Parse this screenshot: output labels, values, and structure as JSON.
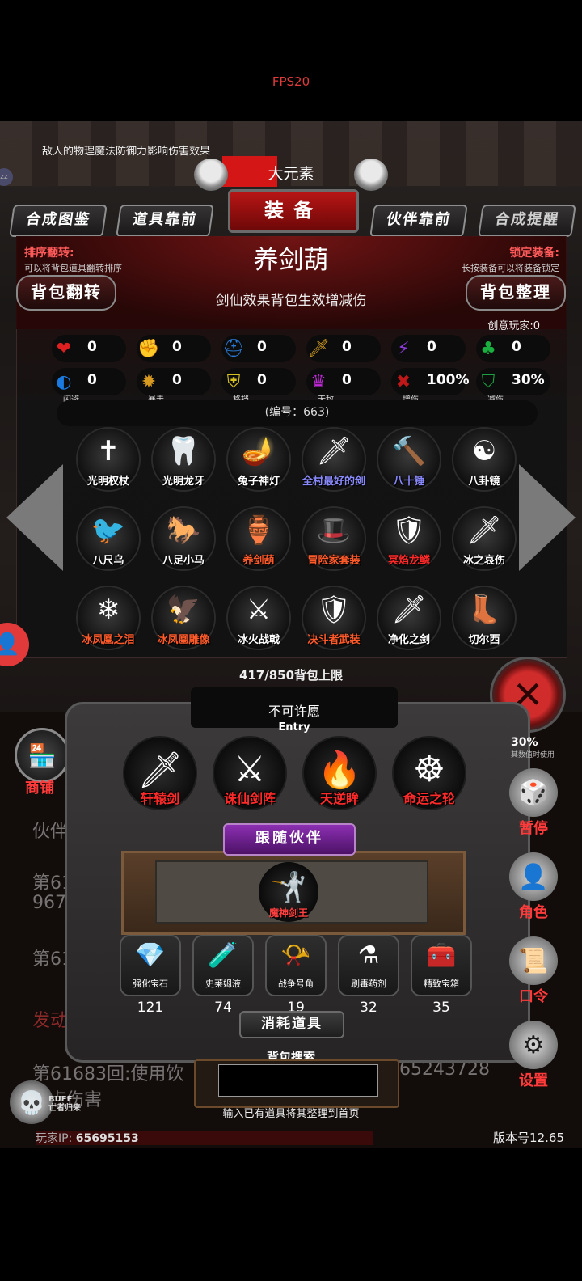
{
  "fps": "FPS20",
  "top_note": "敌人的物理魔法防御力影响伤害效果",
  "top_name": "大元素",
  "title": "装备",
  "nav": {
    "codex": "合成图鉴",
    "items_front": "道具靠前",
    "partner_front": "伙伴靠前",
    "reminder": "合成提醒"
  },
  "left_info": {
    "heading": "排序翻转:",
    "sub": "可以将背包道具翻转排序",
    "button": "背包翻转"
  },
  "right_info": {
    "heading": "锁定装备:",
    "sub": "长按装备可以将装备锁定",
    "button": "背包整理"
  },
  "item_name": "养剑葫",
  "item_desc": "剑仙效果背包生效增减伤",
  "creative_player": "创意玩家:0",
  "stats_row1": [
    {
      "icon": "heart-icon",
      "glyph": "❤",
      "value": "0",
      "color": "#e02020",
      "label": ""
    },
    {
      "icon": "strength-icon",
      "glyph": "✊",
      "value": "0",
      "color": "#d8b020",
      "label": ""
    },
    {
      "icon": "helmet-icon",
      "glyph": "⛑",
      "value": "0",
      "color": "#2a7ad8",
      "label": ""
    },
    {
      "icon": "sword-icon",
      "glyph": "🗡",
      "value": "0",
      "color": "#d8a020",
      "label": ""
    },
    {
      "icon": "lightning-icon",
      "glyph": "⚡",
      "value": "0",
      "color": "#8a3ad8",
      "label": ""
    },
    {
      "icon": "clover-icon",
      "glyph": "♣",
      "value": "0",
      "color": "#1ab040",
      "label": ""
    }
  ],
  "stats_row2": [
    {
      "icon": "dodge-icon",
      "glyph": "◐",
      "value": "0",
      "color": "#1a7ae0",
      "label": "闪避"
    },
    {
      "icon": "crit-icon",
      "glyph": "✹",
      "value": "0",
      "color": "#d89a20",
      "label": "暴击"
    },
    {
      "icon": "block-icon",
      "glyph": "⛨",
      "value": "0",
      "color": "#d8c020",
      "label": "格挡"
    },
    {
      "icon": "invincible-icon",
      "glyph": "♛",
      "value": "0",
      "color": "#c02ad8",
      "label": "无敌"
    },
    {
      "icon": "damage-up-icon",
      "glyph": "✖",
      "value": "100%",
      "color": "#c01818",
      "label": "增伤"
    },
    {
      "icon": "damage-reduce-icon",
      "glyph": "⛉",
      "value": "30%",
      "color": "#1aa040",
      "label": "减伤"
    }
  ],
  "serial": "(编号：663)",
  "inventory": [
    {
      "name": "光明权杖",
      "glyph": "✝",
      "color": "#ffffff"
    },
    {
      "name": "光明龙牙",
      "glyph": "🦷",
      "color": "#ffffff"
    },
    {
      "name": "兔子神灯",
      "glyph": "🪔",
      "color": "#ffffff"
    },
    {
      "name": "全村最好的剑",
      "glyph": "🗡",
      "color": "#8a8aff"
    },
    {
      "name": "八十锤",
      "glyph": "🔨",
      "color": "#8a8aff"
    },
    {
      "name": "八卦镜",
      "glyph": "☯",
      "color": "#ffffff"
    },
    {
      "name": "八尺乌",
      "glyph": "🐦",
      "color": "#ffffff"
    },
    {
      "name": "八足小马",
      "glyph": "🐎",
      "color": "#ffffff"
    },
    {
      "name": "养剑葫",
      "glyph": "🏺",
      "color": "#ff5a2a"
    },
    {
      "name": "冒险家套装",
      "glyph": "🎩",
      "color": "#ff5a2a"
    },
    {
      "name": "冥焰龙鳞",
      "glyph": "🛡",
      "color": "#ff2a2a"
    },
    {
      "name": "冰之哀伤",
      "glyph": "🗡",
      "color": "#ffffff"
    },
    {
      "name": "冰凤凰之泪",
      "glyph": "❄",
      "color": "#ff5a2a"
    },
    {
      "name": "冰凤凰雕像",
      "glyph": "🦅",
      "color": "#ff5a2a"
    },
    {
      "name": "冰火战戟",
      "glyph": "⚔",
      "color": "#ffffff"
    },
    {
      "name": "决斗者武装",
      "glyph": "🛡",
      "color": "#ff5a2a"
    },
    {
      "name": "净化之剑",
      "glyph": "🗡",
      "color": "#ffffff"
    },
    {
      "name": "切尔西",
      "glyph": "👢",
      "color": "#ffffff"
    }
  ],
  "capacity": "417/850背包上限",
  "wish": {
    "title": "不可许愿",
    "sub": "Entry",
    "items": [
      {
        "name": "轩辕剑",
        "glyph": "🗡"
      },
      {
        "name": "诛仙剑阵",
        "glyph": "⚔"
      },
      {
        "name": "天逆眸",
        "glyph": "🔥"
      },
      {
        "name": "命运之轮",
        "glyph": "☸"
      }
    ]
  },
  "follow": {
    "title": "跟随伙伴",
    "partner": {
      "name": "魔神剑王",
      "glyph": "🤺"
    }
  },
  "consumables": {
    "title": "消耗道具",
    "items": [
      {
        "name": "强化宝石",
        "glyph": "💎",
        "count": "121"
      },
      {
        "name": "史莱姆液",
        "glyph": "🧪",
        "count": "74"
      },
      {
        "name": "战争号角",
        "glyph": "📯",
        "count": "19"
      },
      {
        "name": "刷毒药剂",
        "glyph": "⚗",
        "count": "32"
      },
      {
        "name": "精致宝箱",
        "glyph": "🧰",
        "count": "35"
      }
    ]
  },
  "search": {
    "label": "背包搜索",
    "value": "",
    "hint": "输入已有道具将其整理到首页"
  },
  "side": {
    "shop": "商铺",
    "pause": "暂停",
    "role": "角色",
    "password": "口令",
    "settings": "设置",
    "percent": "30%",
    "percent_sub": "其数值时使用"
  },
  "background_log": {
    "partner": "伙伴",
    "line1": "第6168",
    "line2": "967",
    "line3": "第61",
    "line4": "发动",
    "line5": "第61683回:使用饮",
    "line5_tail": "65243728",
    "line6": "点伤害"
  },
  "buff": "BUFF\n亡者归来",
  "player_ip_label": "玩家IP:",
  "player_ip": "65695153",
  "version": "版本号12.65"
}
